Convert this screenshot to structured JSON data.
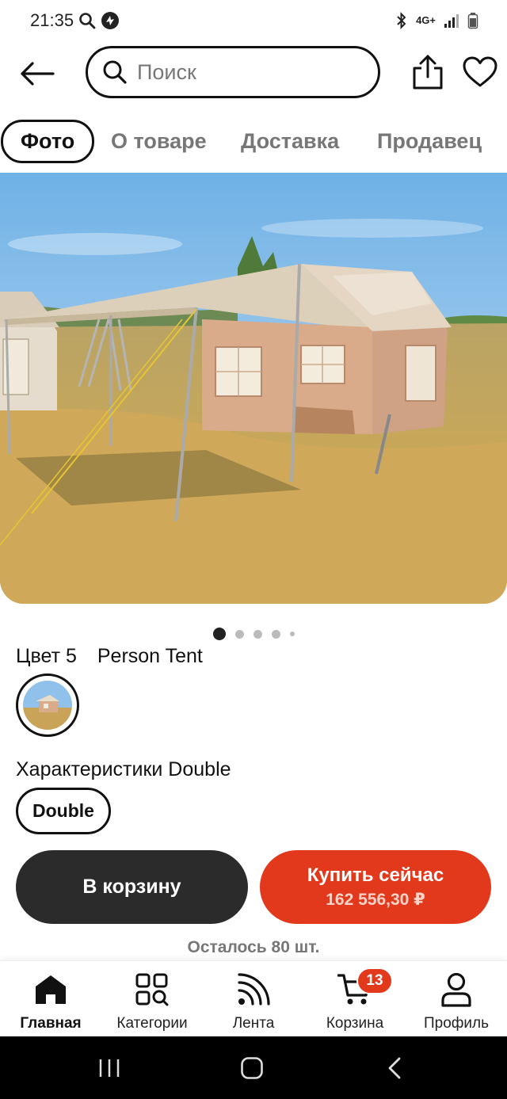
{
  "status_bar": {
    "time": "21:35",
    "network": "4G+"
  },
  "header": {
    "search_placeholder": "Поиск"
  },
  "tabs": [
    {
      "label": "Фото"
    },
    {
      "label": "О товаре"
    },
    {
      "label": "Доставка"
    },
    {
      "label": "Продавец"
    }
  ],
  "gallery": {
    "total_dots": 5,
    "active_index": 0
  },
  "variant": {
    "color_label": "Цвет 5",
    "color_value": "Person Tent",
    "spec_label": "Характеристики Double",
    "spec_option": "Double"
  },
  "actions": {
    "cart_button": "В корзину",
    "buy_button": "Купить сейчас",
    "price": "162 556,30 ₽",
    "stock": "Осталось 80 шт."
  },
  "bottom_nav": {
    "items": [
      {
        "label": "Главная",
        "icon": "home-icon",
        "active": true
      },
      {
        "label": "Категории",
        "icon": "categories-icon",
        "active": false
      },
      {
        "label": "Лента",
        "icon": "feed-icon",
        "active": false
      },
      {
        "label": "Корзина",
        "icon": "cart-icon",
        "active": false
      },
      {
        "label": "Профиль",
        "icon": "profile-icon",
        "active": false
      }
    ],
    "cart_badge": "13"
  },
  "colors": {
    "accent": "#e2381b",
    "dark_button": "#2b2b2b"
  }
}
